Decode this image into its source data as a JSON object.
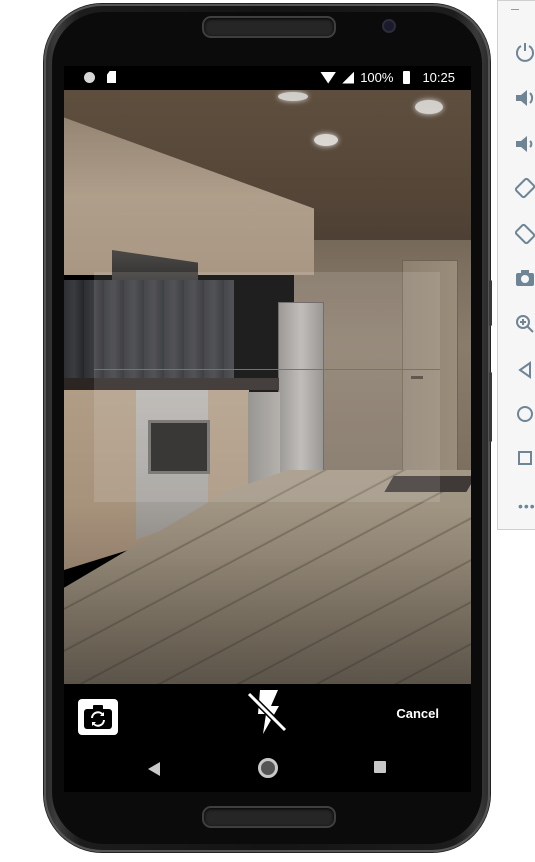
{
  "status_bar": {
    "battery": "100%",
    "time": "10:25",
    "icons": [
      "notification-circle-icon",
      "sd-card-icon",
      "wifi-icon",
      "signal-icon",
      "battery-icon"
    ]
  },
  "viewfinder": {
    "scan_line_color": "#ff3b30"
  },
  "camera_controls": {
    "switch_camera_icon": "camera-switch-icon",
    "flash_icon": "flash-off-icon",
    "cancel_label": "Cancel"
  },
  "nav_bar": {
    "icons": [
      "back-icon",
      "home-icon",
      "recents-icon"
    ]
  },
  "emulator_toolbar": {
    "items": [
      "power-icon",
      "volume-up-icon",
      "volume-down-icon",
      "rotate-left-icon",
      "rotate-right-icon",
      "screenshot-icon",
      "zoom-icon",
      "back-icon",
      "home-icon",
      "overview-icon",
      "more-icon"
    ],
    "icon_color": "#6d8595"
  }
}
